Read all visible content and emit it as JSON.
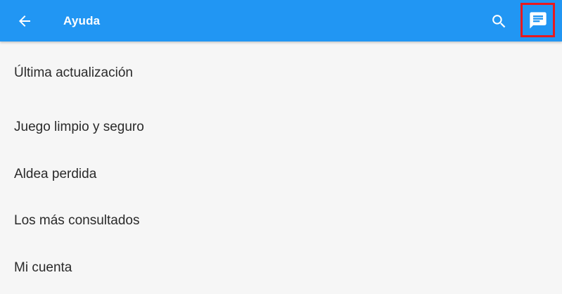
{
  "header": {
    "title": "Ayuda",
    "background_color": "#2196f3",
    "back_icon": "arrow-left-icon",
    "search_icon": "search-icon",
    "chat_icon": "chat-message-icon",
    "chat_highlight_color": "#e8191f"
  },
  "menu": {
    "items": [
      {
        "label": "Última actualización"
      },
      {
        "label": "Juego limpio y seguro"
      },
      {
        "label": "Aldea perdida"
      },
      {
        "label": "Los más consultados"
      },
      {
        "label": "Mi cuenta"
      }
    ]
  }
}
